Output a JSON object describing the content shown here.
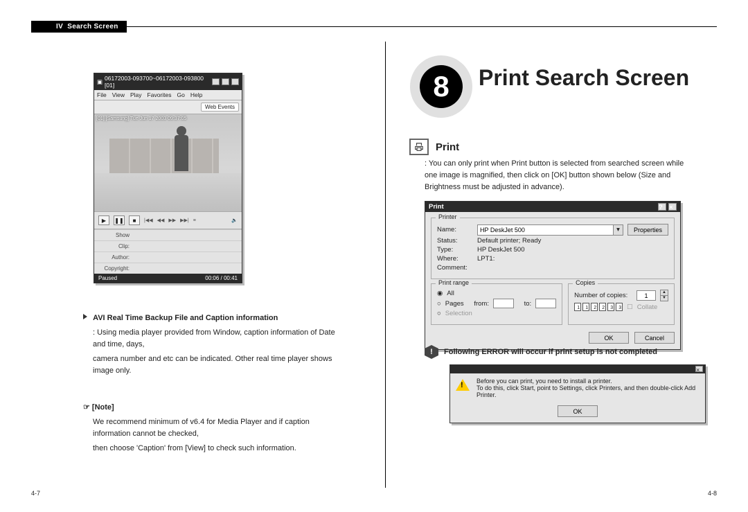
{
  "header": {
    "chapter_roman": "IV",
    "chapter_label": "Search Screen"
  },
  "pageNumbers": {
    "left": "4-7",
    "right": "4-8"
  },
  "leftPage": {
    "mediaPlayer": {
      "title": "06172003-093700~06172003-093800 [01]",
      "menu": [
        "File",
        "View",
        "Play",
        "Favorites",
        "Go",
        "Help"
      ],
      "toolbarLink": "Web Events",
      "overlay": "[01] [Samsung]  Tue Jun 17 2003  09:37:05",
      "infoRows": {
        "show": "Show",
        "clip": "Clip:",
        "author": "Author:",
        "copyright": "Copyright:"
      },
      "status": {
        "state": "Paused",
        "time": "00:06 / 00:41"
      }
    },
    "section": {
      "heading": "AVI Real Time Backup File and Caption information",
      "body1": ": Using media player provided from Window, caption information of Date and time, days,",
      "body2": "camera number and etc can be indicated. Other real time player shows image only.",
      "noteLabel": "[Note]",
      "note1": "We recommend minimum of v6.4 for Media Player and if caption information cannot be checked,",
      "note2": "then choose 'Caption' from [View] to check such information."
    }
  },
  "rightPage": {
    "chapterNum": "8",
    "chapterTitle": "Print Search Screen",
    "printHeading": "Print",
    "printBody1": ": You can only print when Print button is selected from searched screen while",
    "printBody2": "one image is magnified, then click on [OK] button shown below (Size and",
    "printBody3": "Brightness must be adjusted in advance).",
    "printDialog": {
      "title": "Print",
      "groups": {
        "printer": "Printer",
        "range": "Print range",
        "copies": "Copies"
      },
      "labels": {
        "name": "Name:",
        "status": "Status:",
        "type": "Type:",
        "where": "Where:",
        "comment": "Comment:",
        "all": "All",
        "pages": "Pages",
        "from": "from:",
        "to": "to:",
        "selection": "Selection",
        "numCopies": "Number of copies:",
        "collate": "Collate"
      },
      "values": {
        "name": "HP DeskJet 500",
        "status": "Default printer; Ready",
        "type": "HP DeskJet 500",
        "where": "LPT1:",
        "copies": "1"
      },
      "buttons": {
        "properties": "Properties",
        "ok": "OK",
        "cancel": "Cancel"
      }
    },
    "warning": "Following ERROR will occur if print setup is not completed",
    "errorDialog": {
      "line1": "Before you can print, you need to install a printer.",
      "line2": "To do this, click Start, point to Settings, click Printers, and then double-click Add Printer.",
      "ok": "OK"
    }
  }
}
